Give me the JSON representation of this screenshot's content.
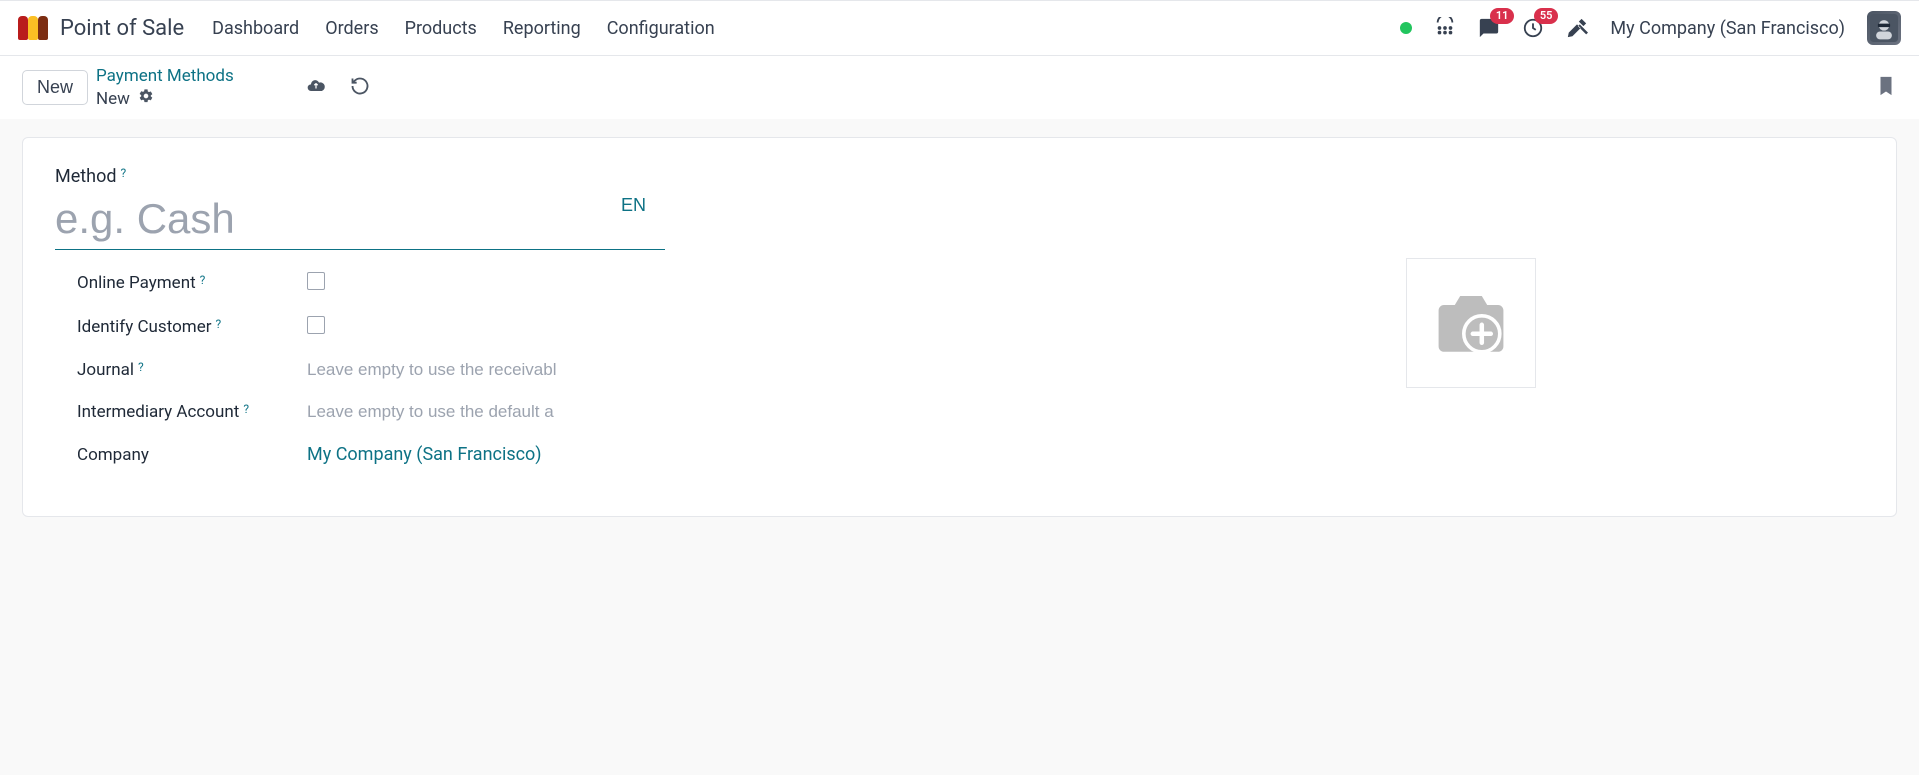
{
  "app": {
    "title": "Point of Sale"
  },
  "nav": {
    "dashboard": "Dashboard",
    "orders": "Orders",
    "products": "Products",
    "reporting": "Reporting",
    "configuration": "Configuration"
  },
  "topbar": {
    "messages_badge": "11",
    "activities_badge": "55",
    "company": "My Company (San Francisco)"
  },
  "subbar": {
    "new_button": "New",
    "breadcrumb_parent": "Payment Methods",
    "breadcrumb_current": "New"
  },
  "form": {
    "method_label": "Method",
    "method_placeholder": "e.g. Cash",
    "method_value": "",
    "lang_btn": "EN",
    "online_payment_label": "Online Payment",
    "identify_customer_label": "Identify Customer",
    "journal_label": "Journal",
    "journal_placeholder": "Leave empty to use the receivabl",
    "journal_value": "",
    "intermediary_label": "Intermediary Account",
    "intermediary_placeholder": "Leave empty to use the default a",
    "intermediary_value": "",
    "company_label": "Company",
    "company_value": "My Company (San Francisco)"
  }
}
